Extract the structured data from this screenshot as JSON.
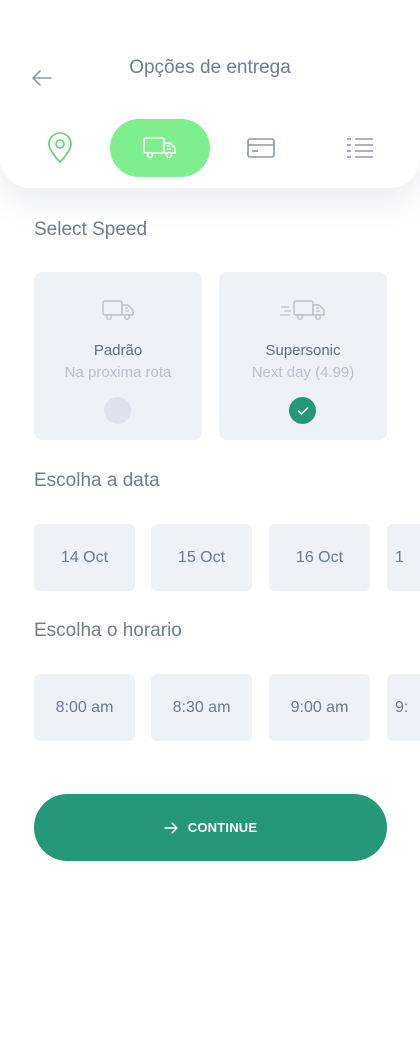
{
  "header": {
    "title": "Opções de entrega",
    "back_icon": "arrow-left-icon"
  },
  "steps": [
    {
      "name": "location",
      "icon": "map-pin-icon",
      "active": false
    },
    {
      "name": "delivery",
      "icon": "truck-icon",
      "active": true
    },
    {
      "name": "payment",
      "icon": "credit-card-icon",
      "active": false
    },
    {
      "name": "summary",
      "icon": "list-icon",
      "active": false
    }
  ],
  "speed": {
    "title": "Select Speed",
    "options": [
      {
        "name": "Padrão",
        "subtitle": "Na proxima rota",
        "selected": false
      },
      {
        "name": "Supersonic",
        "subtitle": "Next day (4.99)",
        "selected": true
      }
    ]
  },
  "date": {
    "title": "Escolha a data",
    "options": [
      "14 Oct",
      "15 Oct",
      "16 Oct",
      "1"
    ]
  },
  "time": {
    "title": "Escolha o horario",
    "options": [
      "8:00 am",
      "8:30 am",
      "9:00 am",
      "9:"
    ]
  },
  "continue": {
    "label": "CONTINUE",
    "icon": "arrow-right-icon"
  },
  "colors": {
    "accent": "#26987a",
    "active_step": "#7fee8e",
    "card_bg": "#eef1f6",
    "icon_green": "#5fd06e"
  }
}
